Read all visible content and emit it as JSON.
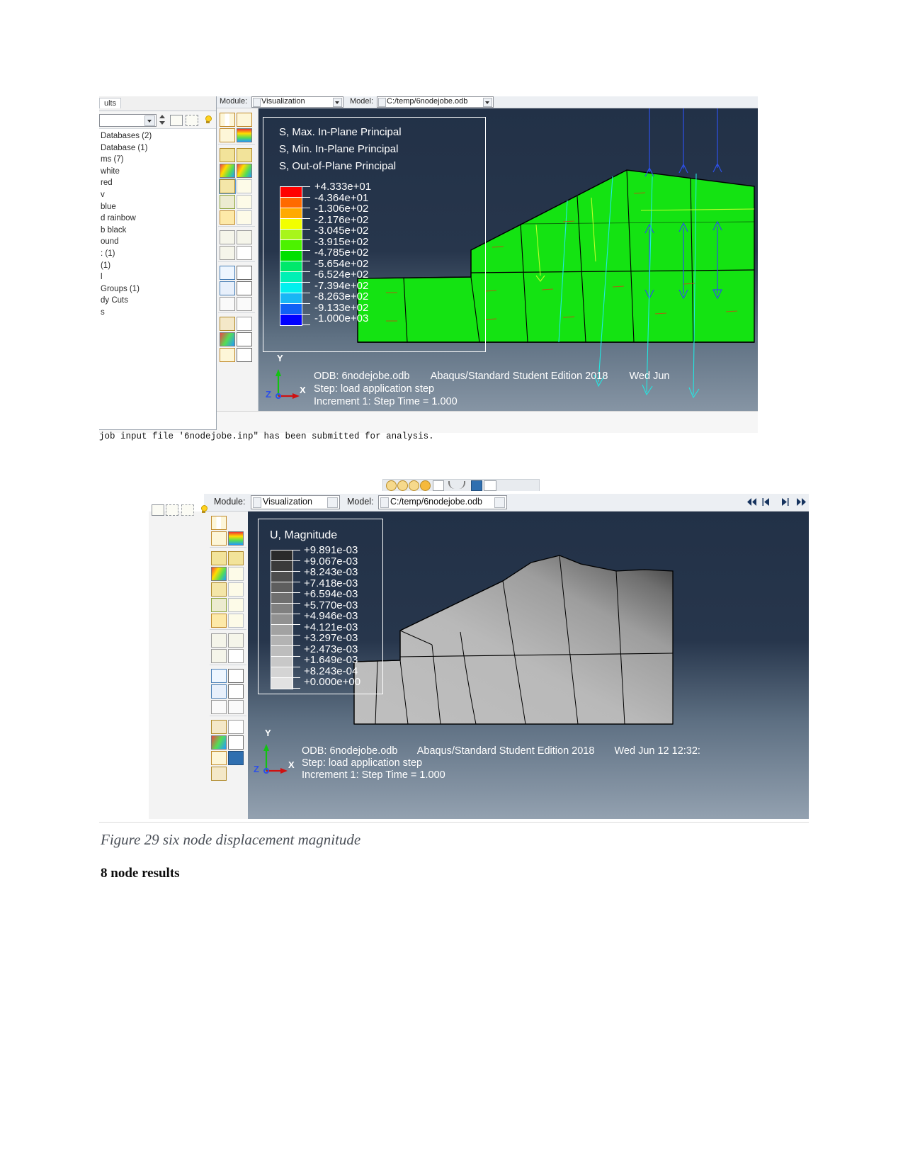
{
  "document": {
    "figure_caption": "Figure 29 six node displacement magnitude",
    "section_heading": "8 node results",
    "message_line": "job input file '6nodejobe.inp\" has been submitted for analysis."
  },
  "figure1": {
    "tree_tab_label": "ults",
    "tree_items": [
      "Databases (2)",
      "Database (1)",
      "ms (7)",
      " white",
      "red",
      "v",
      "blue",
      "d rainbow",
      "b black",
      "ound",
      ": (1)",
      " (1)",
      "l",
      "",
      " Groups (1)",
      "dy Cuts",
      "s"
    ],
    "module_label": "Module:",
    "module_value": "Visualization",
    "model_label": "Model:",
    "model_value": "C:/temp/6nodejobe.odb",
    "legend": {
      "titles": [
        "S, Max. In-Plane Principal",
        "S, Min. In-Plane Principal",
        "S, Out-of-Plane Principal"
      ],
      "values": [
        "+4.333e+01",
        "-4.364e+01",
        "-1.306e+02",
        "-2.176e+02",
        "-3.045e+02",
        "-3.915e+02",
        "-4.785e+02",
        "-5.654e+02",
        "-6.524e+02",
        "-7.394e+02",
        "-8.263e+02",
        "-9.133e+02",
        "-1.000e+03"
      ],
      "colors": [
        "#ff0000",
        "#ff6a00",
        "#ffaa00",
        "#f2ff00",
        "#a8f51b",
        "#4cf200",
        "#00e000",
        "#00e86b",
        "#00f0b4",
        "#00f0ee",
        "#18b6f5",
        "#1060f5",
        "#0000ff"
      ]
    },
    "footer": {
      "odb": "ODB: 6nodejobe.odb",
      "product": "Abaqus/Standard Student Edition 2018",
      "date": "Wed Jun",
      "step": "Step: load application step",
      "increment": "Increment        1: Step Time =     1.000"
    },
    "axes": {
      "x": "X",
      "y": "Y",
      "z": "Z"
    }
  },
  "figure2": {
    "module_label": "Module:",
    "module_value": "Visualization",
    "model_label": "Model:",
    "model_value": "C:/temp/6nodejobe.odb",
    "legend": {
      "title": "U, Magnitude",
      "values": [
        "+9.891e-03",
        "+9.067e-03",
        "+8.243e-03",
        "+7.418e-03",
        "+6.594e-03",
        "+5.770e-03",
        "+4.946e-03",
        "+4.121e-03",
        "+3.297e-03",
        "+2.473e-03",
        "+1.649e-03",
        "+8.243e-04",
        "+0.000e+00"
      ],
      "colors": [
        "#2a2a2a",
        "#3b3b3b",
        "#4d4d4d",
        "#5e5e5e",
        "#6f6f6f",
        "#808080",
        "#919191",
        "#a2a2a2",
        "#b3b3b3",
        "#bdbdbd",
        "#c8c8c8",
        "#d4d4d4",
        "#e2e2e2"
      ]
    },
    "footer": {
      "odb": "ODB: 6nodejobe.odb",
      "product": "Abaqus/Standard Student Edition 2018",
      "date": "Wed Jun 12 12:32:",
      "step": "Step: load application step",
      "increment": "Increment        1: Step Time =     1.000"
    },
    "axes": {
      "x": "X",
      "y": "Y",
      "z": "Z"
    },
    "nav_buttons": [
      "first-frame",
      "previous-frame",
      "next-frame",
      "last-frame"
    ]
  }
}
